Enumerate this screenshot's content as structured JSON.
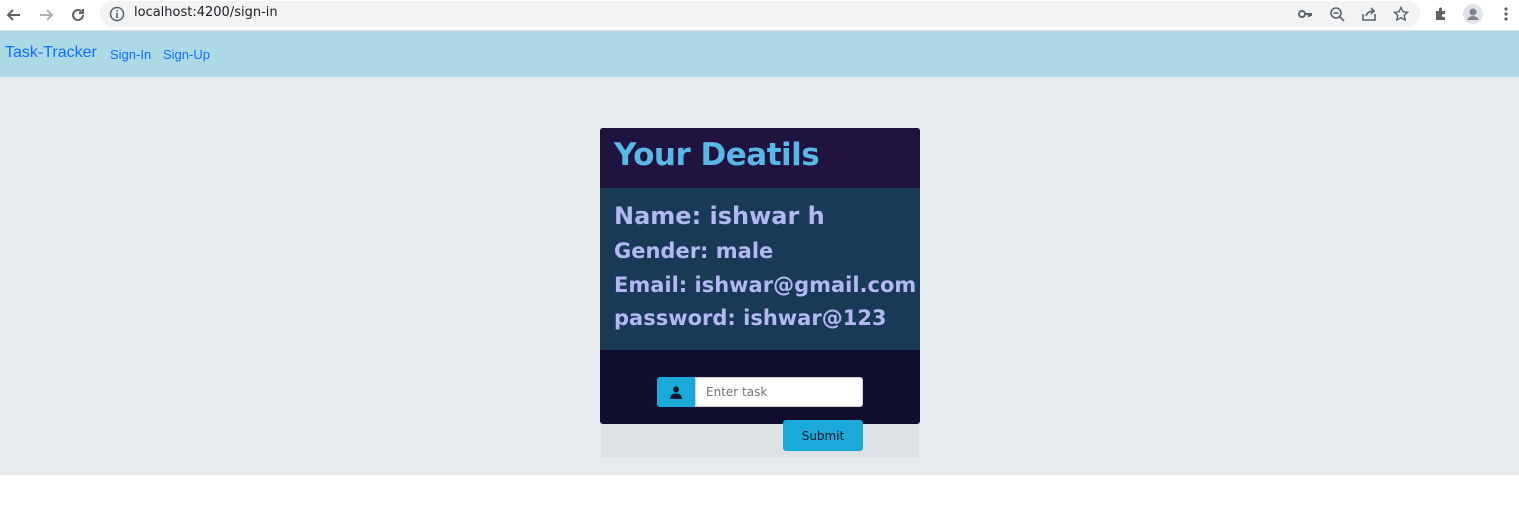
{
  "browser": {
    "url": "localhost:4200/sign-in",
    "icons": [
      "back-icon",
      "forward-icon",
      "reload-icon",
      "info-icon",
      "key-icon",
      "zoom-out-icon",
      "share-icon",
      "star-icon",
      "extensions-icon",
      "profile-icon",
      "menu-icon"
    ]
  },
  "navbar": {
    "brand": "Task-Tracker",
    "links": [
      "Sign-In",
      "Sign-Up"
    ]
  },
  "card": {
    "title": "Your Deatils",
    "name": "Name: ishwar h",
    "gender": "Gender: male",
    "email": "Email: ishwar@gmail.com",
    "password": "password: ishwar@123"
  },
  "task_form": {
    "input_placeholder": "Enter task",
    "input_value": "",
    "submit_label": "Submit"
  },
  "colors": {
    "navbar_bg": "#add8e6",
    "link": "#0d6efd",
    "card_header_bg": "#1f1340",
    "card_body_bg": "#193a57",
    "card_bg": "#0f0e2e",
    "accent": "#1aa9d8",
    "title_text": "#5ab8e8",
    "detail_text": "#b2b8f0"
  }
}
